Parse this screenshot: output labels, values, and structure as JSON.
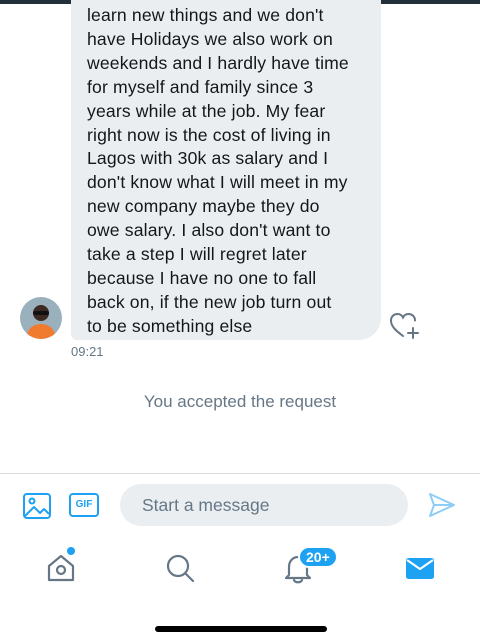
{
  "message": {
    "text": "learn new things and we don't\nhave Holidays we also work on\nweekends and I hardly have time\nfor myself and family since 3\nyears while at the job. My fear\nright now is the cost of living in\nLagos with 30k as salary and I\ndon't know what I will meet in my\nnew company maybe they do\nowe salary. I also don't want to\ntake a step I will regret later\nbecause I have no one to fall\nback on, if the new job turn out\nto be something else",
    "time": "09:21"
  },
  "system_message": "You accepted the request",
  "composer": {
    "placeholder": "Start a message",
    "gif_label": "GIF"
  },
  "tabbar": {
    "notifications_badge": "20+"
  },
  "colors": {
    "accent": "#1da1f2",
    "bubble": "#ebeef0",
    "muted_text": "#657786"
  }
}
